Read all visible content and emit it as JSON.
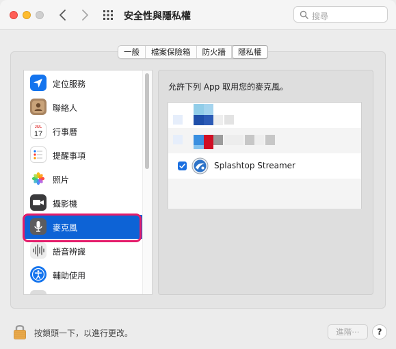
{
  "window": {
    "title": "安全性與隱私權"
  },
  "search": {
    "placeholder": "搜尋"
  },
  "tabs": [
    {
      "label": "一般",
      "active": false
    },
    {
      "label": "檔案保險箱",
      "active": false
    },
    {
      "label": "防火牆",
      "active": false
    },
    {
      "label": "隱私權",
      "active": true
    }
  ],
  "sidebar": {
    "items": [
      {
        "label": "定位服務",
        "icon": "location-arrow-icon"
      },
      {
        "label": "聯絡人",
        "icon": "contacts-icon"
      },
      {
        "label": "行事曆",
        "icon": "calendar-icon",
        "calendar_month": "JUL",
        "calendar_day": "17"
      },
      {
        "label": "提醒事項",
        "icon": "reminders-icon"
      },
      {
        "label": "照片",
        "icon": "photos-icon"
      },
      {
        "label": "攝影機",
        "icon": "camera-icon"
      },
      {
        "label": "麥克風",
        "icon": "microphone-icon",
        "selected": true
      },
      {
        "label": "語音辨識",
        "icon": "speech-recognition-icon"
      },
      {
        "label": "輔助使用",
        "icon": "accessibility-icon"
      }
    ]
  },
  "panel": {
    "header": "允許下列 App 取用您的麥克風。",
    "apps": [
      {
        "name": "Splashtop Streamer",
        "checked": true,
        "icon": "splashtop-icon"
      }
    ]
  },
  "footer": {
    "lock_text": "按鎖頭一下，以進行更改。",
    "advanced_label": "進階⋯",
    "help_label": "?"
  },
  "colors": {
    "accent": "#0d63d6",
    "highlight_ring": "#e41c6a"
  }
}
